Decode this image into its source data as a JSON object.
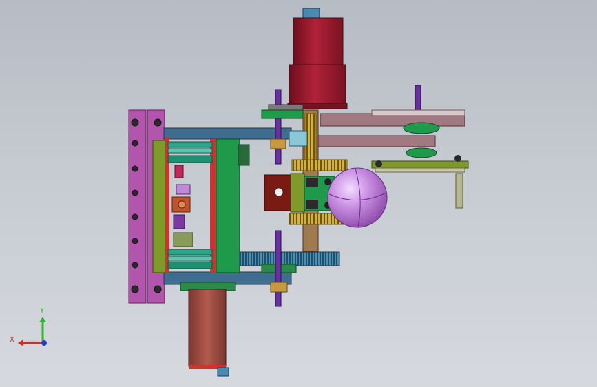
{
  "viewport": {
    "background_top": "#b6bcc4",
    "background_bottom": "#d6d9de"
  },
  "triad": {
    "x_label": "X",
    "y_label": "Y",
    "x_color": "#d42a2a",
    "y_color": "#2eb82e",
    "z_color": "#2a3ad4"
  },
  "colors": {
    "motor_red": "#8e1628",
    "motor_red_light": "#b02238",
    "motor_brown": "#9a4a40",
    "plate_magenta": "#b255ad",
    "frame_blue": "#3f6d8f",
    "plate_green": "#1f9a4a",
    "plate_olive": "#7f9a2a",
    "rail_teal": "#2aa58a",
    "gear_blue": "#3c7fa0",
    "bar_purple": "#6a2ea0",
    "belt_mauve": "#a07a80",
    "sphere": "#c68ee0",
    "brass": "#c89a40"
  }
}
